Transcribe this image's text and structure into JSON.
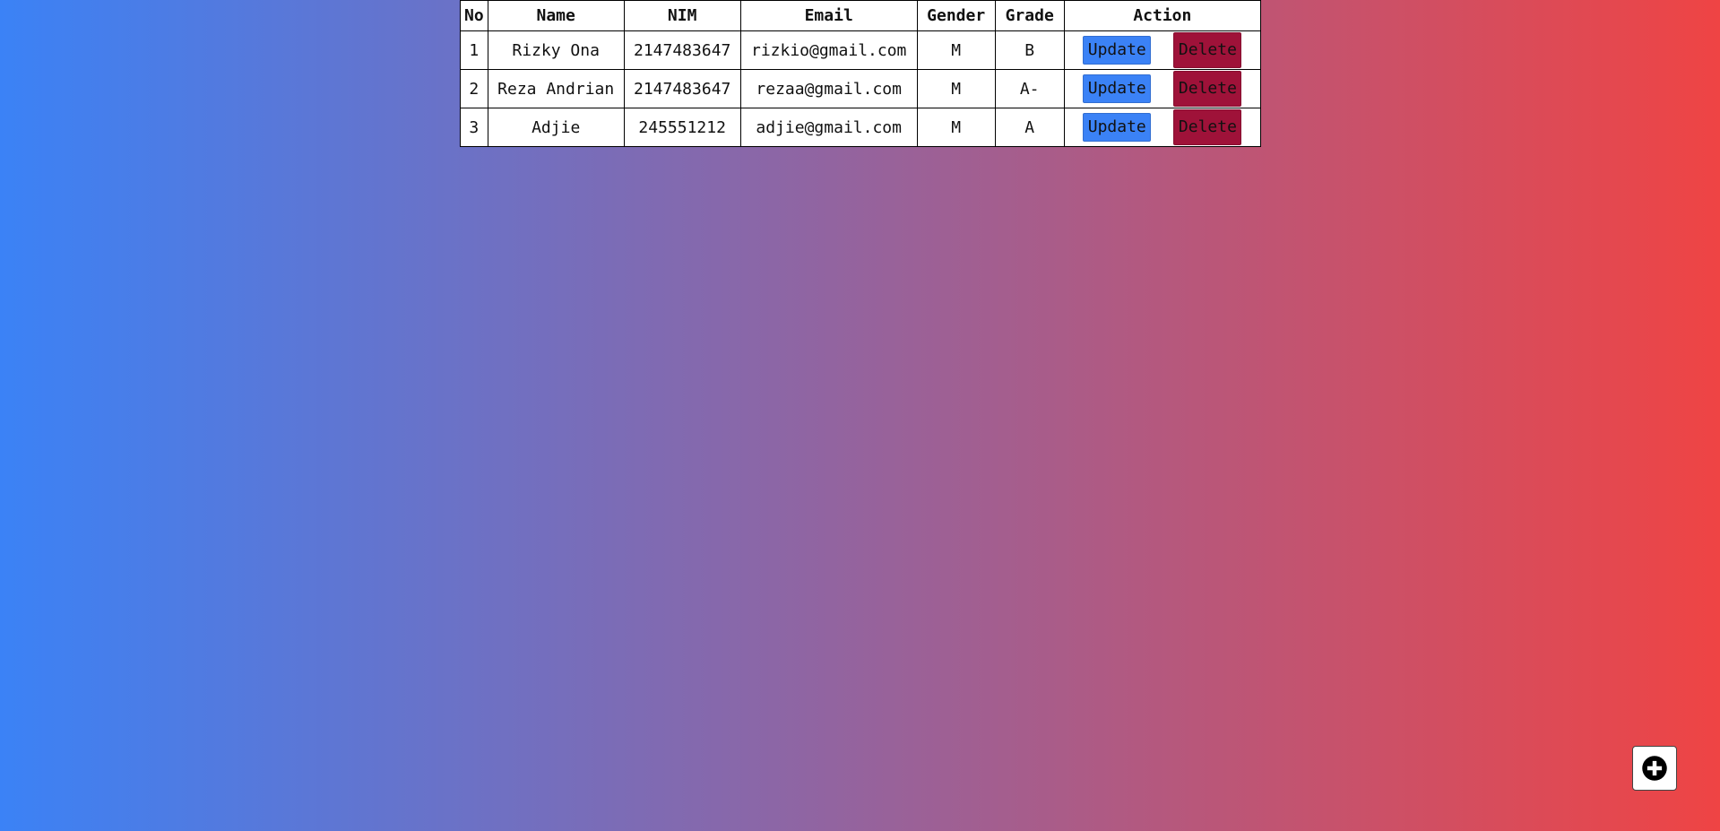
{
  "table": {
    "headers": [
      "No",
      "Name",
      "NIM",
      "Email",
      "Gender",
      "Grade",
      "Action"
    ],
    "rows": [
      {
        "no": "1",
        "name": "Rizky Ona",
        "nim": "2147483647",
        "email": "rizkio@gmail.com",
        "gender": "M",
        "grade": "B"
      },
      {
        "no": "2",
        "name": "Reza Andrian",
        "nim": "2147483647",
        "email": "rezaa@gmail.com",
        "gender": "M",
        "grade": "A-"
      },
      {
        "no": "3",
        "name": "Adjie",
        "nim": "245551212",
        "email": "adjie@gmail.com",
        "gender": "M",
        "grade": "A"
      }
    ],
    "update_label": "Update",
    "delete_label": "Delete"
  },
  "fab": {
    "icon": "plus-circle-icon"
  },
  "colors": {
    "gradient_start": "#3b82f6",
    "gradient_end": "#ef4444",
    "update_button": "#3b82f6",
    "delete_button": "#9f1239"
  }
}
